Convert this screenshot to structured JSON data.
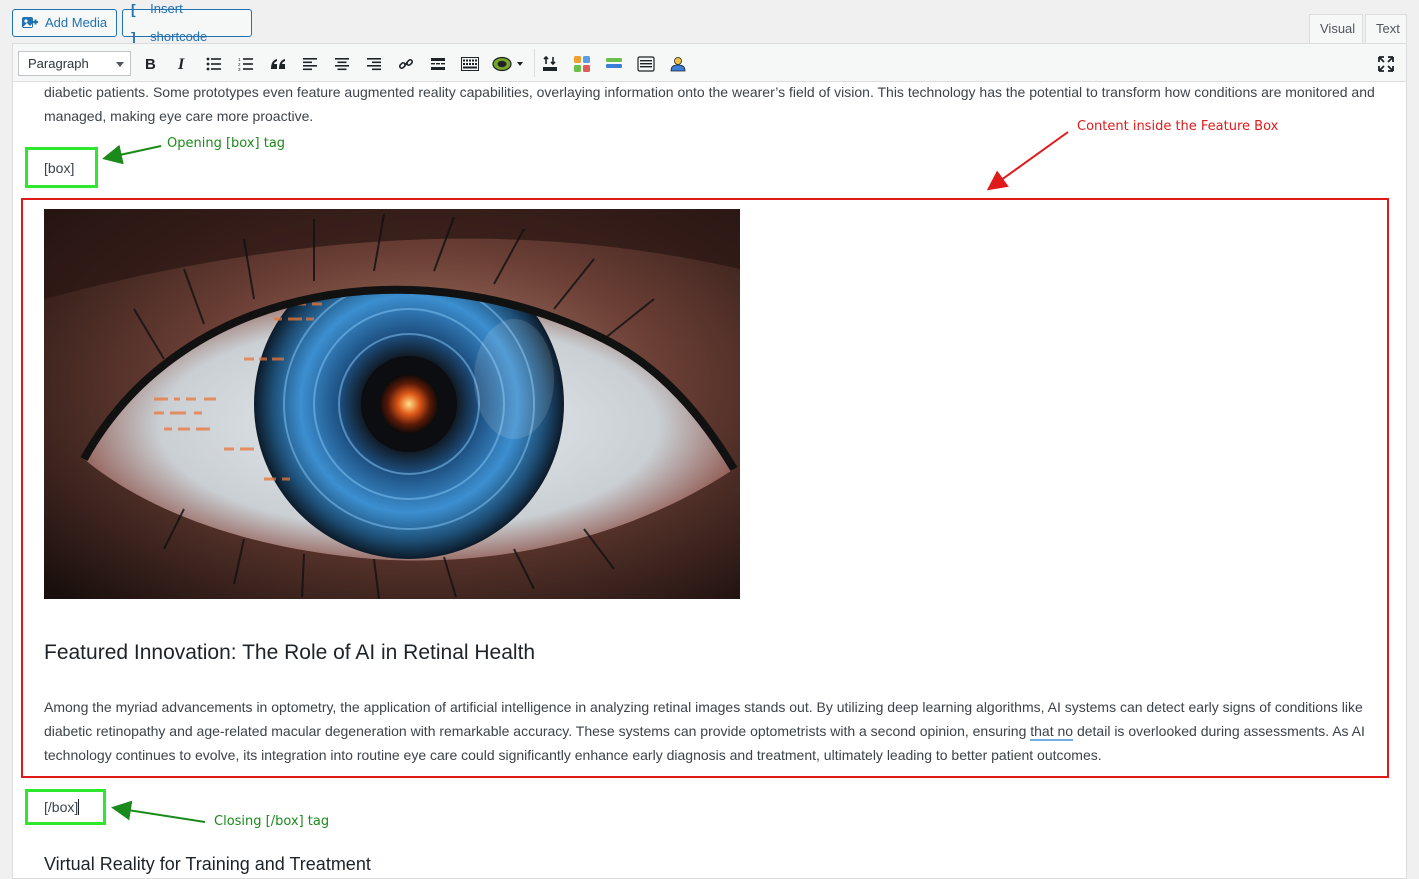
{
  "topbar": {
    "add_media": "Add Media",
    "insert_shortcode": "Insert shortcode",
    "tab_visual": "Visual",
    "tab_text": "Text"
  },
  "toolbar": {
    "format": "Paragraph",
    "buttons": [
      "bold-icon",
      "italic-icon",
      "bulleted-list-icon",
      "numbered-list-icon",
      "blockquote-icon",
      "align-left-icon",
      "align-center-icon",
      "align-right-icon",
      "link-icon",
      "read-more-icon",
      "toolbar-toggle-icon",
      "plugin-icon",
      "upload-icon",
      "blocks-icon",
      "layers-icon",
      "table-icon",
      "user-icon",
      "fullscreen-icon"
    ]
  },
  "content": {
    "intro_line1": "diabetic patients. Some prototypes even feature augmented reality capabilities, overlaying information onto the wearer’s field of vision. This technology has the potential to transform how conditions are monitored and",
    "intro_line2": "managed, making eye care more proactive.",
    "open_tag": "[box]",
    "close_tag": "[/box]",
    "feature_heading": "Featured Innovation: The Role of AI in Retinal Health",
    "feature_p1": "Among the myriad advancements in optometry, the application of artificial intelligence in analyzing retinal images stands out. By utilizing deep learning algorithms, AI systems can detect early signs of conditions like",
    "feature_p2_a": "diabetic retinopathy and age-related macular degeneration with remarkable accuracy. These systems can provide optometrists with a second opinion, ensuring ",
    "feature_p2_u": "that no",
    "feature_p2_b": " detail is overlooked during assessments. As AI",
    "feature_p3": "technology continues to evolve, its integration into routine eye care could significantly enhance early diagnosis and treatment, ultimately leading to better patient outcomes.",
    "next_heading": "Virtual Reality for Training and Treatment"
  },
  "annotations": {
    "opening": "Opening [box] tag",
    "closing": "Closing [/box] tag",
    "content": "Content inside the Feature Box"
  },
  "colors": {
    "annotation_green": "#1a8a1a",
    "highlight_green": "#2ee82e",
    "annotation_red": "#e01a1a",
    "wp_blue": "#2271b1"
  }
}
